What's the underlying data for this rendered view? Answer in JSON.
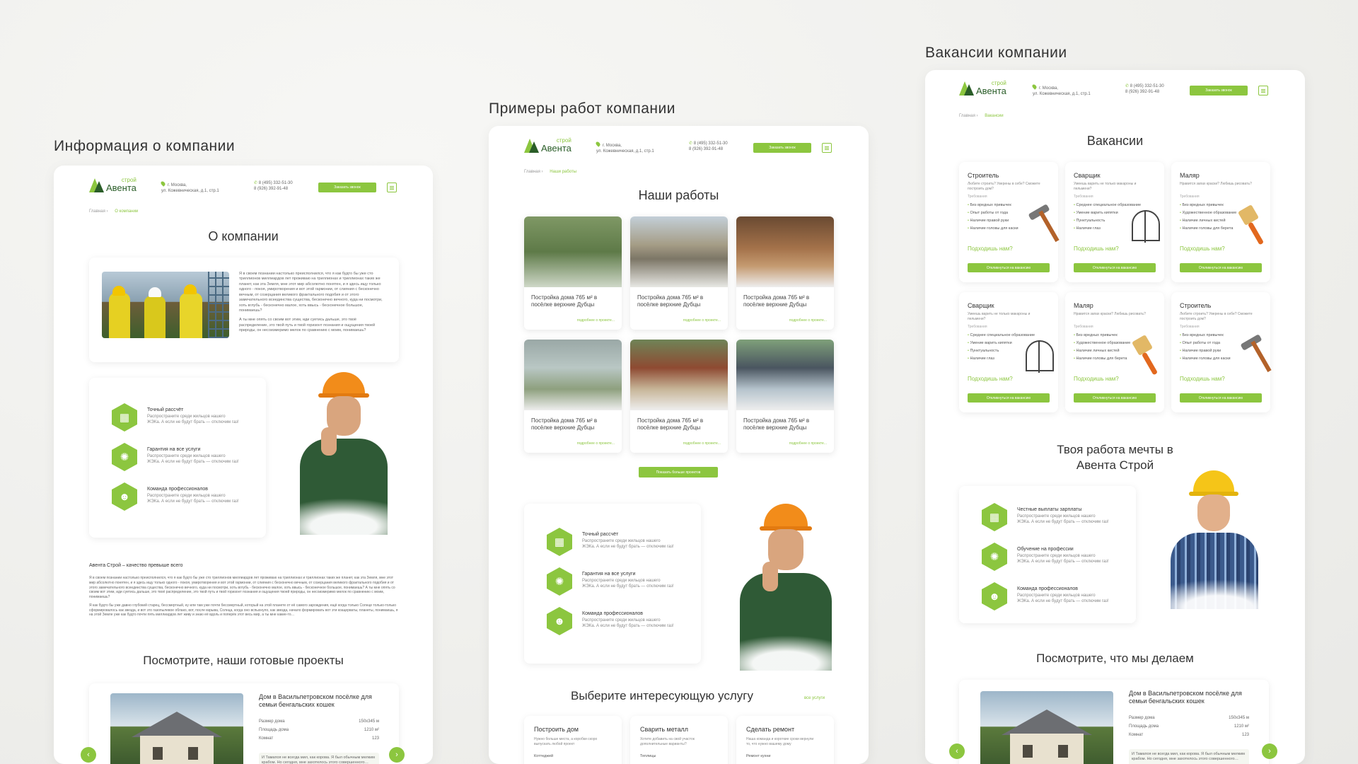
{
  "accent": "#8cc63f",
  "panels": [
    {
      "title": "Информация о компании",
      "header": {
        "logo_text": "Авента",
        "logo_sub": "строй",
        "address": "г. Москва,\nул. Кожевническая, д.1, стр.1",
        "phone": "8 (495) 332-51-30\n8 (926) 392-91-48",
        "cta": "Заказать звонок"
      },
      "breadcrumbs": {
        "home": "Главная",
        "current": "О компании"
      },
      "heading": "О компании",
      "about_text_1": "Я в своем познании настолько преисполнился, что я как будто бы уже сто триллионов миллиардов лет проживаю на триллионах и триллионах таких же планет, как эта Земля, мне этот мир абсолютно понятен, и я здесь ищу только одного - покоя, умиротворения и вот этой гармонии, от слияния с бесконечно вечным, от созерцания великого фрактального подобия и от этого замечательного всеединства существа, бесконечно вечного, куда ни посмотри, хоть вглубь - бесконечно малое, хоть ввысь - бесконечное большое, понимаешь?",
      "about_text_2": "А ты мне опять со своим вот этим, иди суетись дальше, это твоё распределение, это твой путь и твой горизонт познания и ощущения твоей природы, он несоизмеримо мелок по сравнению с моим, понимаешь?",
      "features": [
        {
          "title": "Точный рассчёт",
          "desc": "Распространите среди жильцов нашего ЖЭКа. А если не будут брать — отключим газ!"
        },
        {
          "title": "Гарантия на все услуги",
          "desc": "Распространите среди жильцов нашего ЖЭКа. А если не будут брать — отключим газ!"
        },
        {
          "title": "Команда профессионалов",
          "desc": "Распространите среди жильцов нашего ЖЭКа. А если не будут брать — отключим газ!"
        }
      ],
      "quality_title": "Авента Строй – качество превыше всего",
      "quality_text": "Я в своем познании настолько преисполнился, что я как будто бы уже сто триллионов миллиардов лет проживаю на триллионах и триллионах таких же планет, как эта Земля, мне этот мир абсолютно понятен, и я здесь ищу только одного - покоя, умиротворения и вот этой гармонии, от слияния с бесконечно вечным, от созерцания великого фрактального подобия и от этого замечательного всеединства существа, бесконечно вечного, куда ни посмотри, хоть вглубь - бесконечно малое, хоть ввысь - бесконечное большое, понимаешь? А ты мне опять со своим вот этим, иди суетись дальше, это твоё распределение, это твой путь и твой горизонт познания и ощущения твоей природы, он несоизмеримо мелок по сравнению с моим, понимаешь?",
      "quality_text_2": "Я как будто бы уже давно глубокий старец, бессмертный, ну или там уже почти бессмертный, который на этой планете от её самого зарождения, ещё когда только Солнце только-только сформировалось как звезда, и вот это газопылевое облако, вот, после взрыва, Солнца, когда оно вспыхнуло, как звезда, начало формировать вот эти коацерваты, планеты, понимаешь, я на этой Земле уже как будто почти пять миллиардов лет живу и знаю её вдоль и поперёк этот весь мир, а ты мне какие-то…",
      "projects_heading": "Посмотрите,  наши готовые проекты",
      "project": {
        "title": "Дом в Васильпетровском посёлке для семьи бенгальских кошек",
        "rows": [
          [
            "Размер дома",
            "150х345 м"
          ],
          [
            "Площадь дома",
            "1210 м²"
          ],
          [
            "Комнат",
            "123"
          ]
        ],
        "quote": "И Тамапоя не всегда мил, как корова. Я был обычным мелким крабом. Но сегодня, мне захотелось этого совершенного…"
      }
    },
    {
      "title": "Примеры работ компании",
      "breadcrumbs": {
        "home": "Главная",
        "current": "Наши работы"
      },
      "heading": "Наши работы",
      "works": [
        {
          "caption": "Постройка дома 765 м² в посёлке верхние Дубцы",
          "more": "подробнее о проекте..."
        },
        {
          "caption": "Постройка дома 765 м² в посёлке верхние Дубцы",
          "more": "подробнее о проекте..."
        },
        {
          "caption": "Постройка дома 765 м² в посёлке верхние Дубцы",
          "more": "подробнее о проекте..."
        },
        {
          "caption": "Постройка дома 765 м² в посёлке верхние Дубцы",
          "more": "подробнее о проекте..."
        },
        {
          "caption": "Постройка дома 765 м² в посёлке верхние Дубцы",
          "more": "подробнее о проекте..."
        },
        {
          "caption": "Постройка дома 765 м² в посёлке верхние Дубцы",
          "more": "подробнее о проекте..."
        }
      ],
      "more_button": "Показать больше проектов",
      "services_heading": "Выберите интересующую услугу",
      "services_all": "все услуги",
      "services": [
        {
          "title": "Построить дом",
          "desc": "Нужно больше места, а коробки скоро выпускать любой проект",
          "item": "Коттеджей"
        },
        {
          "title": "Сварить металл",
          "desc": "Хотите добавить на свой участок дополнительные варианты?",
          "item": "Теплицы"
        },
        {
          "title": "Сделать ремонт",
          "desc": "Наша команда и короткие сроки вернули то, что нужно вашему дому",
          "item": "Ремонт кухни"
        }
      ]
    },
    {
      "title": "Вакансии компании",
      "breadcrumbs": {
        "home": "Главная",
        "current": "Вакансии"
      },
      "heading": "Вакансии",
      "requirements_label": "Требования",
      "fit_label": "Подходишь нам?",
      "apply_label": "Откликнуться на вакансию",
      "vacancies": [
        {
          "title": "Строитель",
          "q": "Любите строить? Уверены в себе? Сможете построить дом?",
          "items": [
            "Без вредных привычек",
            "Опыт работы от года",
            "Наличие правой руки",
            "Наличие головы для каски"
          ],
          "tool": "hammer-icon"
        },
        {
          "title": "Сварщик",
          "q": "Умеешь варить не только макароны и пельмени?",
          "items": [
            "Среднее специальное образование",
            "Умение варить кипятки",
            "Пунктуальность",
            "Наличие глаз"
          ],
          "tool": "welding-frame-icon"
        },
        {
          "title": "Маляр",
          "q": "Нравится запах краски? Любишь рисовать?",
          "items": [
            "Без вредных привычек",
            "Художественное образование",
            "Наличие личных кистей",
            "Наличие головы для берета"
          ],
          "tool": "brush-icon"
        },
        {
          "title": "Сварщик",
          "q": "Умеешь варить не только макароны и пельмени?",
          "items": [
            "Среднее специальное образование",
            "Умение варить кипятки",
            "Пунктуальность",
            "Наличие глаз"
          ],
          "tool": "welding-frame-icon"
        },
        {
          "title": "Маляр",
          "q": "Нравится запах краски? Любишь рисовать?",
          "items": [
            "Без вредных привычек",
            "Художественное образование",
            "Наличие личных кистей",
            "Наличие головы для берета"
          ],
          "tool": "brush-icon"
        },
        {
          "title": "Строитель",
          "q": "Любите строить? Уверены в себе? Сможете построить дом?",
          "items": [
            "Без вредных привычек",
            "Опыт работы от года",
            "Наличие правой руки",
            "Наличие головы для каски"
          ],
          "tool": "hammer-icon"
        }
      ],
      "dream_heading_1": "Твоя работа мечты в",
      "dream_heading_2": "Авента Строй",
      "features": [
        {
          "title": "Честные выплаты зарплаты",
          "desc": "Распространите среди жильцов нашего ЖЭКа. А если не будут брать — отключим газ!"
        },
        {
          "title": "Обучение на профессии",
          "desc": "Распространите среди жильцов нашего ЖЭКа. А если не будут брать — отключим газ!"
        },
        {
          "title": "Команда профессионалов",
          "desc": "Распространите среди жильцов нашего ЖЭКа. А если не будут брать — отключим газ!"
        }
      ],
      "what_heading": "Посмотрите, что мы делаем"
    }
  ]
}
